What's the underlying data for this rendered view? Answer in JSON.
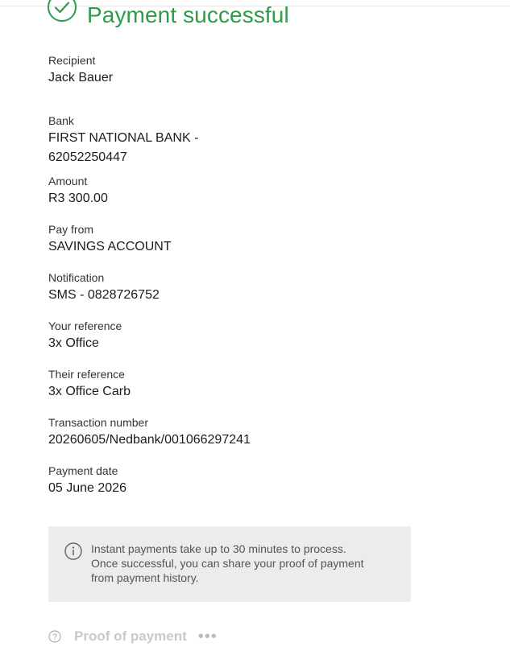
{
  "header": {
    "title": "Payment successful",
    "icon": "check-circle-icon",
    "accent_color": "#2f9a4a"
  },
  "fields": [
    {
      "label": "Recipient",
      "value": "Jack Bauer"
    },
    {
      "label": "Bank",
      "value": "FIRST NATIONAL BANK -",
      "value2": "62052250447"
    },
    {
      "label": "Amount",
      "value": "R3 300.00"
    },
    {
      "label": "Pay from",
      "value": "SAVINGS ACCOUNT"
    },
    {
      "label": "Notification",
      "value": "SMS - 0828726752"
    },
    {
      "label": "Your reference",
      "value": "3x Office"
    },
    {
      "label": "Their reference",
      "value": "3x Office Carb"
    },
    {
      "label": "Transaction number",
      "value": "20260605/Nedbank/001066297241"
    },
    {
      "label": "Payment date",
      "value": "05 June 2026"
    }
  ],
  "info": {
    "icon": "info-icon",
    "line1": "Instant payments take up to 30 minutes to process.",
    "line2": "Once successful, you can share your proof of payment",
    "line3": "from payment history."
  },
  "footer": {
    "help_icon": "help-icon",
    "proof_label": "Proof of payment",
    "more_label": "•••"
  }
}
